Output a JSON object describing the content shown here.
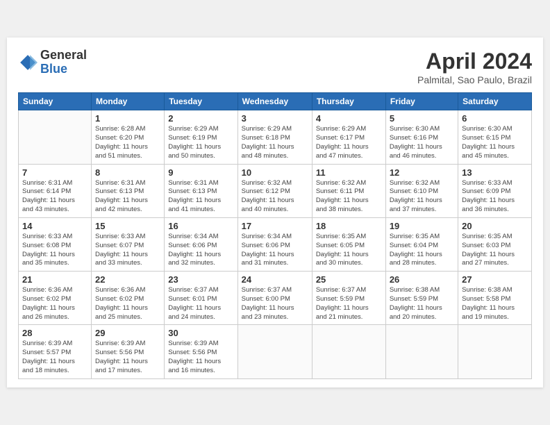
{
  "header": {
    "logo_general": "General",
    "logo_blue": "Blue",
    "title": "April 2024",
    "location": "Palmital, Sao Paulo, Brazil"
  },
  "days_of_week": [
    "Sunday",
    "Monday",
    "Tuesday",
    "Wednesday",
    "Thursday",
    "Friday",
    "Saturday"
  ],
  "weeks": [
    [
      {
        "day": "",
        "info": ""
      },
      {
        "day": "1",
        "info": "Sunrise: 6:28 AM\nSunset: 6:20 PM\nDaylight: 11 hours\nand 51 minutes."
      },
      {
        "day": "2",
        "info": "Sunrise: 6:29 AM\nSunset: 6:19 PM\nDaylight: 11 hours\nand 50 minutes."
      },
      {
        "day": "3",
        "info": "Sunrise: 6:29 AM\nSunset: 6:18 PM\nDaylight: 11 hours\nand 48 minutes."
      },
      {
        "day": "4",
        "info": "Sunrise: 6:29 AM\nSunset: 6:17 PM\nDaylight: 11 hours\nand 47 minutes."
      },
      {
        "day": "5",
        "info": "Sunrise: 6:30 AM\nSunset: 6:16 PM\nDaylight: 11 hours\nand 46 minutes."
      },
      {
        "day": "6",
        "info": "Sunrise: 6:30 AM\nSunset: 6:15 PM\nDaylight: 11 hours\nand 45 minutes."
      }
    ],
    [
      {
        "day": "7",
        "info": "Sunrise: 6:31 AM\nSunset: 6:14 PM\nDaylight: 11 hours\nand 43 minutes."
      },
      {
        "day": "8",
        "info": "Sunrise: 6:31 AM\nSunset: 6:13 PM\nDaylight: 11 hours\nand 42 minutes."
      },
      {
        "day": "9",
        "info": "Sunrise: 6:31 AM\nSunset: 6:13 PM\nDaylight: 11 hours\nand 41 minutes."
      },
      {
        "day": "10",
        "info": "Sunrise: 6:32 AM\nSunset: 6:12 PM\nDaylight: 11 hours\nand 40 minutes."
      },
      {
        "day": "11",
        "info": "Sunrise: 6:32 AM\nSunset: 6:11 PM\nDaylight: 11 hours\nand 38 minutes."
      },
      {
        "day": "12",
        "info": "Sunrise: 6:32 AM\nSunset: 6:10 PM\nDaylight: 11 hours\nand 37 minutes."
      },
      {
        "day": "13",
        "info": "Sunrise: 6:33 AM\nSunset: 6:09 PM\nDaylight: 11 hours\nand 36 minutes."
      }
    ],
    [
      {
        "day": "14",
        "info": "Sunrise: 6:33 AM\nSunset: 6:08 PM\nDaylight: 11 hours\nand 35 minutes."
      },
      {
        "day": "15",
        "info": "Sunrise: 6:33 AM\nSunset: 6:07 PM\nDaylight: 11 hours\nand 33 minutes."
      },
      {
        "day": "16",
        "info": "Sunrise: 6:34 AM\nSunset: 6:06 PM\nDaylight: 11 hours\nand 32 minutes."
      },
      {
        "day": "17",
        "info": "Sunrise: 6:34 AM\nSunset: 6:06 PM\nDaylight: 11 hours\nand 31 minutes."
      },
      {
        "day": "18",
        "info": "Sunrise: 6:35 AM\nSunset: 6:05 PM\nDaylight: 11 hours\nand 30 minutes."
      },
      {
        "day": "19",
        "info": "Sunrise: 6:35 AM\nSunset: 6:04 PM\nDaylight: 11 hours\nand 28 minutes."
      },
      {
        "day": "20",
        "info": "Sunrise: 6:35 AM\nSunset: 6:03 PM\nDaylight: 11 hours\nand 27 minutes."
      }
    ],
    [
      {
        "day": "21",
        "info": "Sunrise: 6:36 AM\nSunset: 6:02 PM\nDaylight: 11 hours\nand 26 minutes."
      },
      {
        "day": "22",
        "info": "Sunrise: 6:36 AM\nSunset: 6:02 PM\nDaylight: 11 hours\nand 25 minutes."
      },
      {
        "day": "23",
        "info": "Sunrise: 6:37 AM\nSunset: 6:01 PM\nDaylight: 11 hours\nand 24 minutes."
      },
      {
        "day": "24",
        "info": "Sunrise: 6:37 AM\nSunset: 6:00 PM\nDaylight: 11 hours\nand 23 minutes."
      },
      {
        "day": "25",
        "info": "Sunrise: 6:37 AM\nSunset: 5:59 PM\nDaylight: 11 hours\nand 21 minutes."
      },
      {
        "day": "26",
        "info": "Sunrise: 6:38 AM\nSunset: 5:59 PM\nDaylight: 11 hours\nand 20 minutes."
      },
      {
        "day": "27",
        "info": "Sunrise: 6:38 AM\nSunset: 5:58 PM\nDaylight: 11 hours\nand 19 minutes."
      }
    ],
    [
      {
        "day": "28",
        "info": "Sunrise: 6:39 AM\nSunset: 5:57 PM\nDaylight: 11 hours\nand 18 minutes."
      },
      {
        "day": "29",
        "info": "Sunrise: 6:39 AM\nSunset: 5:56 PM\nDaylight: 11 hours\nand 17 minutes."
      },
      {
        "day": "30",
        "info": "Sunrise: 6:39 AM\nSunset: 5:56 PM\nDaylight: 11 hours\nand 16 minutes."
      },
      {
        "day": "",
        "info": ""
      },
      {
        "day": "",
        "info": ""
      },
      {
        "day": "",
        "info": ""
      },
      {
        "day": "",
        "info": ""
      }
    ]
  ]
}
